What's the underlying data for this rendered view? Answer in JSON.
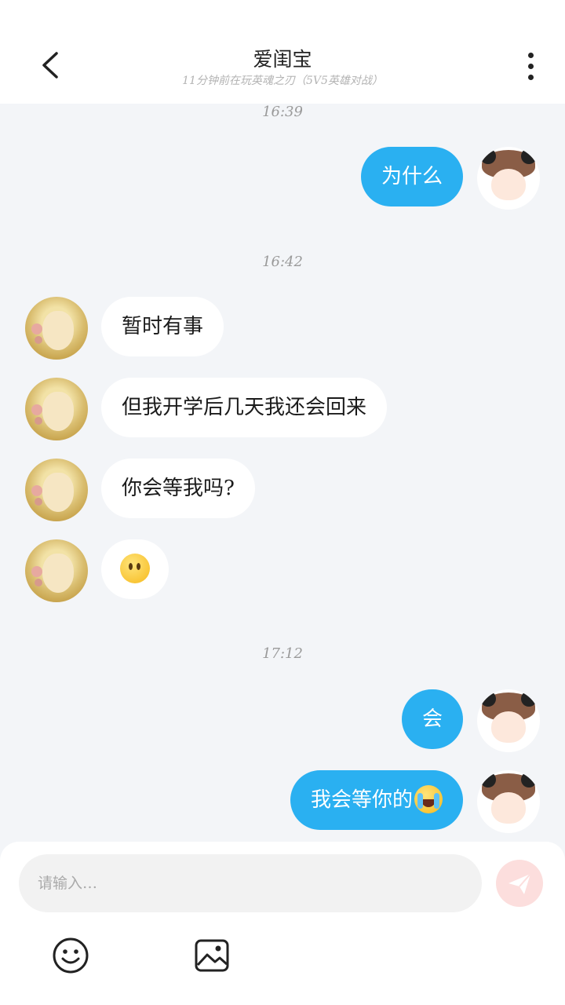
{
  "header": {
    "title": "爱闺宝",
    "subtitle": "11分钟前在玩英魂之刃（5V5英雄对战）"
  },
  "messages": [
    {
      "time": "16:39"
    },
    {
      "side": "right",
      "text": "为什么"
    },
    {
      "time": "16:42"
    },
    {
      "side": "left",
      "text": "暂时有事"
    },
    {
      "side": "left",
      "text": "但我开学后几天我还会回来"
    },
    {
      "side": "left",
      "text": "你会等我吗?"
    },
    {
      "side": "left",
      "emoji": "neutral-face-emoji"
    },
    {
      "time": "17:12"
    },
    {
      "side": "right",
      "text": "会"
    },
    {
      "side": "right",
      "text": "我会等你的",
      "emoji": "crying-face-emoji"
    }
  ],
  "composer": {
    "placeholder": "请输入…",
    "send_color": "#fcdedd"
  },
  "toolbar": {
    "icons": [
      "smiley-icon",
      "image-icon"
    ]
  },
  "colors": {
    "outgoing_bubble": "#2ab0f1",
    "incoming_bubble": "#ffffff",
    "background": "#f3f5f8"
  }
}
